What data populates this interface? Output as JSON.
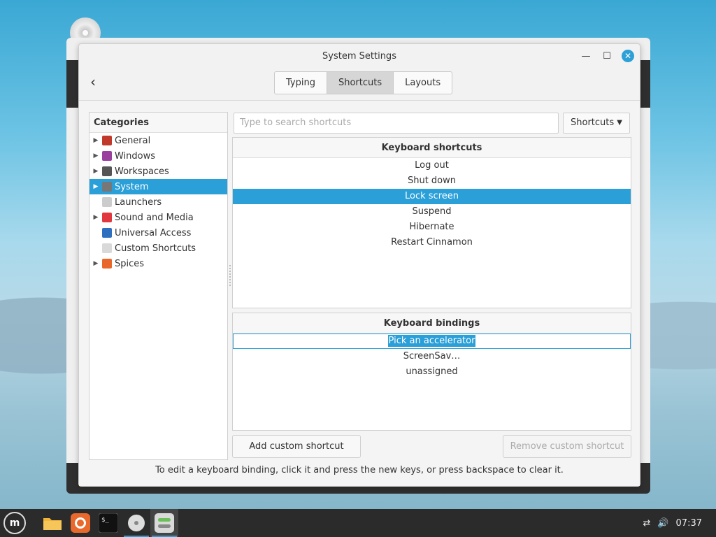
{
  "window": {
    "title": "System Settings",
    "tabs": [
      "Typing",
      "Shortcuts",
      "Layouts"
    ],
    "active_tab": "Shortcuts"
  },
  "categories": {
    "header": "Categories",
    "items": [
      {
        "label": "General",
        "has_arrow": true,
        "icon": "general-icon",
        "color": "#c0392b"
      },
      {
        "label": "Windows",
        "has_arrow": true,
        "icon": "windows-icon",
        "color": "#9b3f9e"
      },
      {
        "label": "Workspaces",
        "has_arrow": true,
        "icon": "workspaces-icon",
        "color": "#555555"
      },
      {
        "label": "System",
        "has_arrow": true,
        "icon": "system-icon",
        "color": "#777777",
        "selected": true
      },
      {
        "label": "Launchers",
        "has_arrow": false,
        "icon": "launchers-icon",
        "color": "#cccccc"
      },
      {
        "label": "Sound and Media",
        "has_arrow": true,
        "icon": "sound-media-icon",
        "color": "#e0383e"
      },
      {
        "label": "Universal Access",
        "has_arrow": false,
        "icon": "universal-access-icon",
        "color": "#2f6fbf"
      },
      {
        "label": "Custom Shortcuts",
        "has_arrow": false,
        "icon": "custom-shortcuts-icon",
        "color": "#d9d9d9"
      },
      {
        "label": "Spices",
        "has_arrow": true,
        "icon": "spices-icon",
        "color": "#e8672a"
      }
    ]
  },
  "search": {
    "placeholder": "Type to search shortcuts"
  },
  "dropdown": {
    "label": "Shortcuts"
  },
  "keyboard_shortcuts": {
    "header": "Keyboard shortcuts",
    "rows": [
      "Log out",
      "Shut down",
      "Lock screen",
      "Suspend",
      "Hibernate",
      "Restart Cinnamon"
    ],
    "selected": "Lock screen"
  },
  "keyboard_bindings": {
    "header": "Keyboard bindings",
    "editing_row": "Pick an accelerator",
    "rows": [
      "ScreenSav…",
      "unassigned"
    ]
  },
  "buttons": {
    "add": "Add custom shortcut",
    "remove": "Remove custom shortcut"
  },
  "hint": "To edit a keyboard binding, click it and press the new keys, or press backspace to clear it.",
  "taskbar": {
    "clock": "07:37",
    "apps": [
      "files-icon",
      "firefox-icon",
      "terminal-icon",
      "disc-icon",
      "settings-icon"
    ]
  },
  "colors": {
    "accent": "#2a9fd8",
    "taskbar": "#2b2b2b"
  }
}
